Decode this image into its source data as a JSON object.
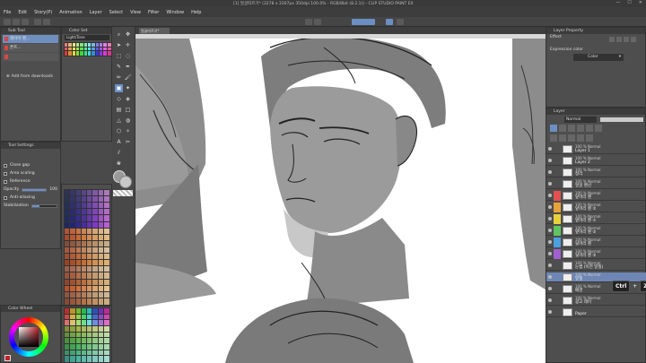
{
  "window": {
    "title": "[1] 얼굴따르기* (2278 x 3307px 350dpi 100.0%  - RGB/8bit  (8.2.1)) - CLIP STUDIO PAINT EX",
    "controls": [
      "—",
      "☐",
      "✕"
    ]
  },
  "menu": [
    "File",
    "Edit",
    "Story(P)",
    "Animation",
    "Layer",
    "Select",
    "View",
    "Filter",
    "Window",
    "Help"
  ],
  "sub_tool": {
    "header": "Sub Tool",
    "items": [
      {
        "label": "레이어 펜...",
        "selected": true
      },
      {
        "label": "폰트..."
      },
      {
        "label": ""
      }
    ],
    "add_from_downloads": "Add from downloads"
  },
  "color_set": {
    "header": "Color Set",
    "name": "Light/Tone"
  },
  "tool_property": {
    "header": "Tool Settings",
    "rows": [
      {
        "label": "Close gap",
        "checked": true,
        "value": ""
      },
      {
        "label": "Area scaling",
        "checked": true,
        "value": ""
      },
      {
        "label": "Reference",
        "checked": true,
        "value": ""
      },
      {
        "label": "Opacity",
        "checked": false,
        "value": "100",
        "level": 1.0
      },
      {
        "label": "Anti-aliasing",
        "checked": true,
        "value": ""
      },
      {
        "label": "Stabilization",
        "checked": false,
        "value": "",
        "level": 0.3
      }
    ]
  },
  "color_wheel": {
    "header": "Color Wheel"
  },
  "canvas": {
    "tab_label": "얼굴따르기*"
  },
  "object_panel": {
    "header": "Layer Property",
    "label": "Effect",
    "expression_color_label": "Expression color",
    "expression_color_value": "Color"
  },
  "layers": {
    "header": "Layer",
    "blend_mode": "Normal",
    "opacity": "100",
    "rows": [
      {
        "mode": "100 % Normal",
        "name": "Layer 1",
        "color": ""
      },
      {
        "mode": "100 % Normal",
        "name": "Layer 2",
        "color": ""
      },
      {
        "mode": "100 % Normal",
        "name": "정리",
        "color": ""
      },
      {
        "mode": "100 % Normal",
        "name": "얼굴 펜선",
        "color": ""
      },
      {
        "mode": "100 % Normal",
        "name": "앞머리 펜",
        "color": "#e45050"
      },
      {
        "mode": "100 % Normal",
        "name": "앞머리 펜 ②",
        "color": "#e8a23a"
      },
      {
        "mode": "100 % Normal",
        "name": "옆머리 펜 ①",
        "color": "#e8d23a"
      },
      {
        "mode": "100 % Normal",
        "name": "옆머리 펜 ②",
        "color": "#5fc45f"
      },
      {
        "mode": "100 % Normal",
        "name": "뒷머리 펜",
        "color": "#4aa0e0"
      },
      {
        "mode": "100 % Normal",
        "name": "뒷머리 펜 ②",
        "color": "#a060d0"
      },
      {
        "mode": "100 % Normal",
        "name": "눈썹 (이전 밑칠)",
        "color": ""
      },
      {
        "mode": "100 % Normal",
        "name": "밑칠",
        "color": "",
        "selected": true
      },
      {
        "mode": "100 % Normal",
        "name": "배경",
        "color": ""
      },
      {
        "mode": "100 % Normal",
        "name": "광고 레이",
        "color": ""
      },
      {
        "mode": "",
        "name": "Paper",
        "color": ""
      }
    ]
  },
  "shortcut_overlay": {
    "key": "Ctrl",
    "plus": "+",
    "letter": "Z"
  }
}
